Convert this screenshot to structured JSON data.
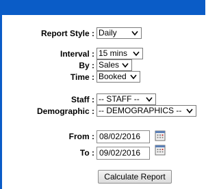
{
  "report_style": {
    "label": "Report Style :",
    "value": "Daily"
  },
  "interval": {
    "label": "Interval :",
    "value": "15 mins"
  },
  "by": {
    "label": "By :",
    "value": "Sales"
  },
  "time": {
    "label": "Time :",
    "value": "Booked"
  },
  "staff": {
    "label": "Staff :",
    "value": "-- STAFF --"
  },
  "demographic": {
    "label": "Demographic :",
    "value": "-- DEMOGRAPHICS --"
  },
  "from": {
    "label": "From :",
    "value": "08/02/2016"
  },
  "to": {
    "label": "To :",
    "value": "09/02/2016"
  },
  "calculate_button": {
    "label": "Calculate Report"
  },
  "icons": {
    "chevron": "chevron-down-icon",
    "calendar": "calendar-icon"
  },
  "colors": {
    "header": "#0a5cc7"
  }
}
